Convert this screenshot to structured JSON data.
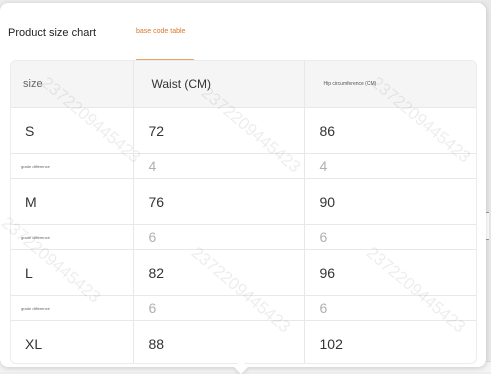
{
  "header": {
    "title": "Product size chart",
    "tab_label": "base code table",
    "accent_color": "#d9772b"
  },
  "table": {
    "columns": [
      "size",
      "Waist (CM)",
      "Hip circumference (CM)"
    ],
    "rows": [
      {
        "type": "size",
        "label": "S",
        "waist": "72",
        "hip": "86"
      },
      {
        "type": "diff",
        "label": "grade difference",
        "waist": "4",
        "hip": "4"
      },
      {
        "type": "size",
        "label": "M",
        "waist": "76",
        "hip": "90"
      },
      {
        "type": "diff",
        "label": "grade difference",
        "waist": "6",
        "hip": "6"
      },
      {
        "type": "size",
        "label": "L",
        "waist": "82",
        "hip": "96"
      },
      {
        "type": "diff",
        "label": "grade difference",
        "waist": "6",
        "hip": "6"
      },
      {
        "type": "size",
        "label": "XL",
        "waist": "88",
        "hip": "102"
      }
    ]
  },
  "watermark": "2372209445423"
}
